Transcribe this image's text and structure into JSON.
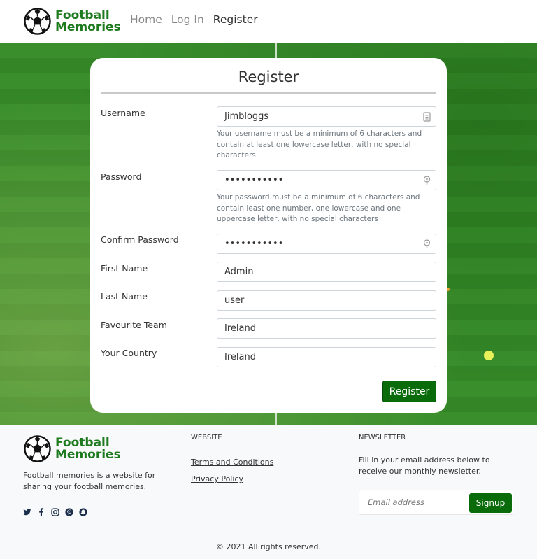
{
  "header": {
    "logo_line1": "Football",
    "logo_line2": "Memories",
    "nav": [
      {
        "label": "Home"
      },
      {
        "label": "Log In"
      },
      {
        "label": "Register"
      }
    ]
  },
  "form": {
    "title": "Register",
    "username": {
      "label": "Username",
      "value": "Jimbloggs",
      "help": "Your username must be a minimum of 6 characters and contain at least one lowercase letter, with no special characters"
    },
    "password": {
      "label": "Password",
      "value": "•••••••••••",
      "help": "Your password must be a minimum of 6 characters and contain least one number, one lowercase and one uppercase letter, with no special characters"
    },
    "confirm_password": {
      "label": "Confirm Password",
      "value": "•••••••••••"
    },
    "first_name": {
      "label": "First Name",
      "value": "Admin"
    },
    "last_name": {
      "label": "Last Name",
      "value": "user"
    },
    "favourite_team": {
      "label": "Favourite Team",
      "value": "Ireland"
    },
    "country": {
      "label": "Your Country",
      "value": "Ireland"
    },
    "submit_label": "Register"
  },
  "footer": {
    "logo_line1": "Football",
    "logo_line2": "Memories",
    "description": "Football memories is a website for sharing your football memories.",
    "website_heading": "WEBSITE",
    "links": [
      {
        "label": "Terms and Conditions"
      },
      {
        "label": "Privacy Policy"
      }
    ],
    "newsletter_heading": "NEWSLETTER",
    "newsletter_text": "Fill in your email address below to receive our monthly newsletter.",
    "email_placeholder": "Email address",
    "signup_label": "Signup",
    "copyright": "© 2021 All rights reserved.",
    "social_icons": [
      "twitter-icon",
      "facebook-icon",
      "instagram-icon",
      "pinterest-icon",
      "snapchat-icon"
    ]
  },
  "colors": {
    "brand_green": "#1e7a1e",
    "button_green": "#0a6b0a"
  }
}
